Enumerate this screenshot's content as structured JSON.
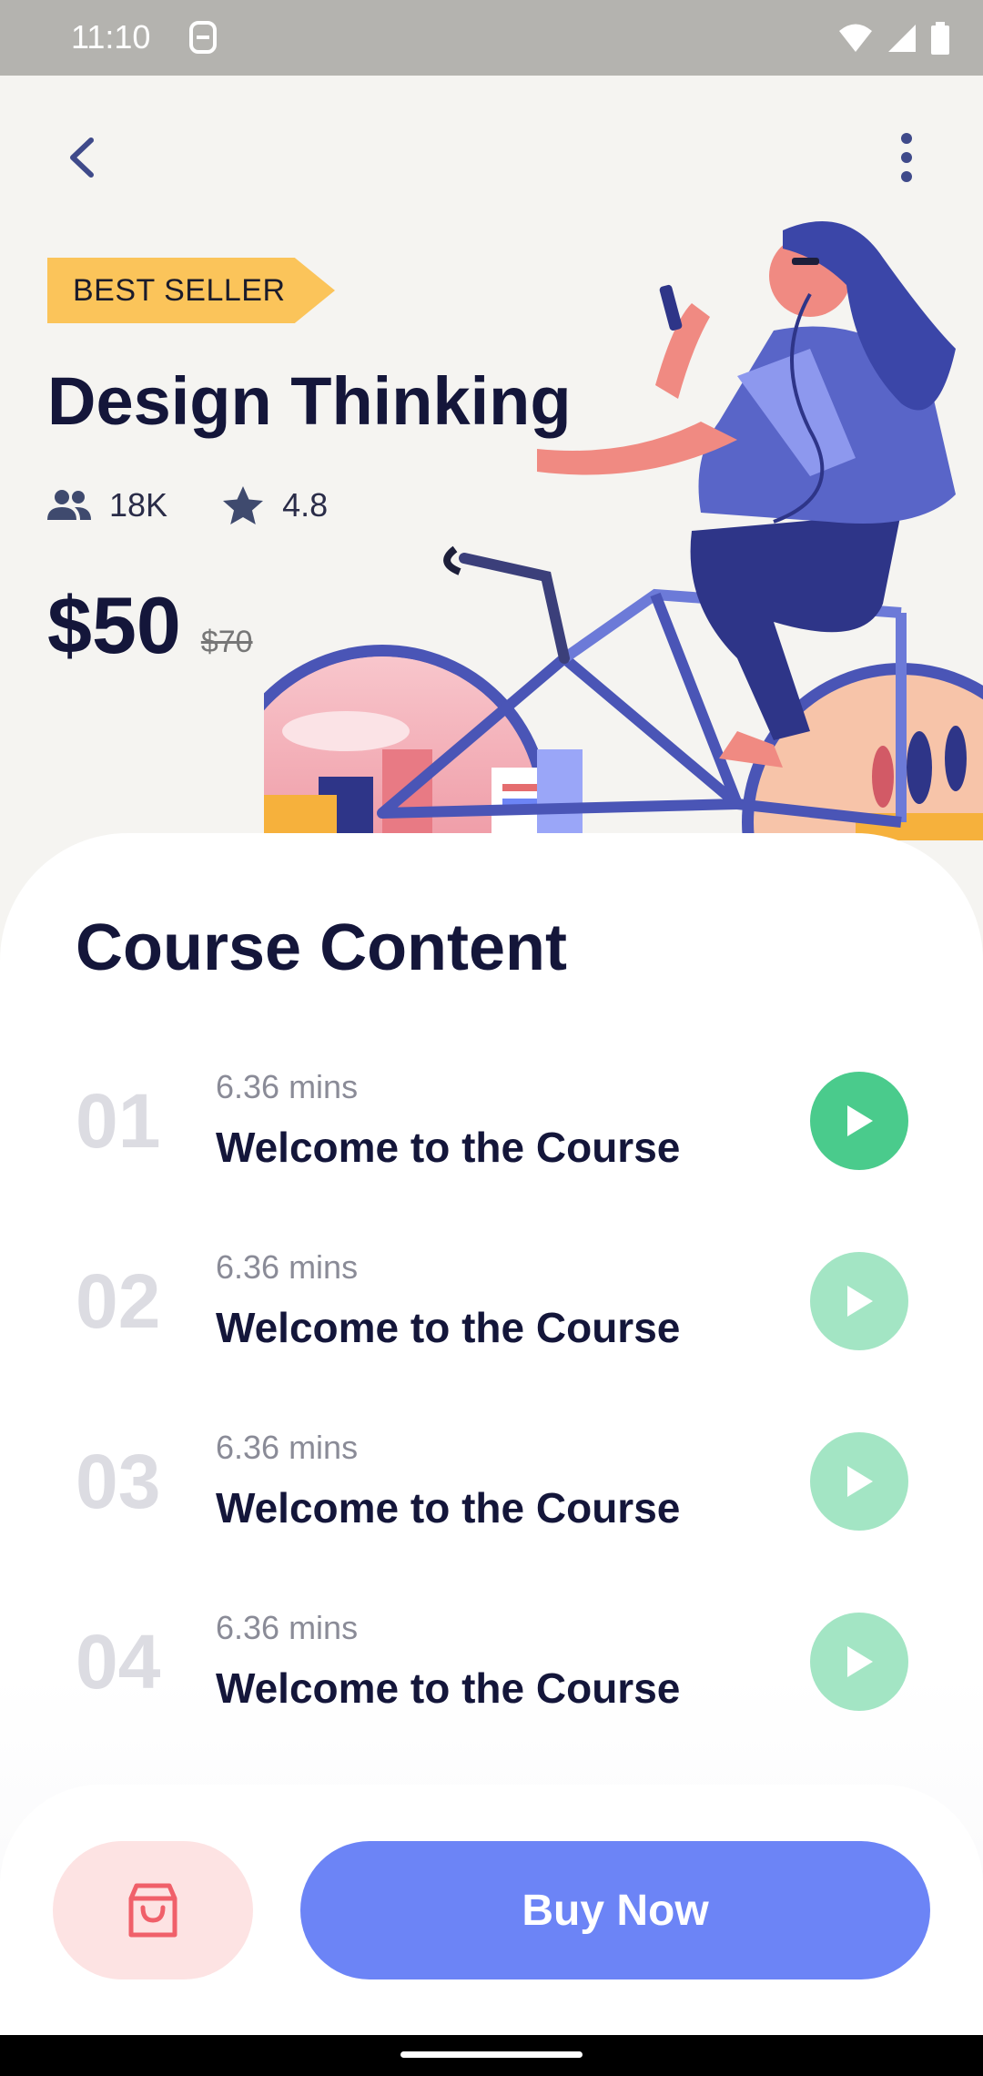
{
  "status_bar": {
    "time": "11:10"
  },
  "header": {
    "back_icon": "chevron-left-icon",
    "more_icon": "more-vertical-icon"
  },
  "course": {
    "badge": "BEST SELLER",
    "title": "Design Thinking",
    "students": "18K",
    "rating": "4.8",
    "price": "$50",
    "old_price": "$70"
  },
  "content": {
    "heading": "Course Content",
    "lessons": [
      {
        "number": "01",
        "duration": "6.36 mins",
        "title": "Welcome to the Course",
        "state": "active"
      },
      {
        "number": "02",
        "duration": "6.36 mins",
        "title": "Welcome to the Course",
        "state": "locked"
      },
      {
        "number": "03",
        "duration": "6.36 mins",
        "title": "Welcome to the Course",
        "state": "locked"
      },
      {
        "number": "04",
        "duration": "6.36 mins",
        "title": "Welcome to the Course",
        "state": "locked"
      }
    ]
  },
  "actions": {
    "cart_icon": "shopping-bag-icon",
    "buy_label": "Buy Now"
  },
  "colors": {
    "accent": "#6c84f6",
    "badge": "#fbc45a",
    "play_active": "#4acb8c",
    "play_inactive": "#a3e5c4",
    "cart_bg": "#fde3e3",
    "cart_icon": "#f0606a"
  }
}
